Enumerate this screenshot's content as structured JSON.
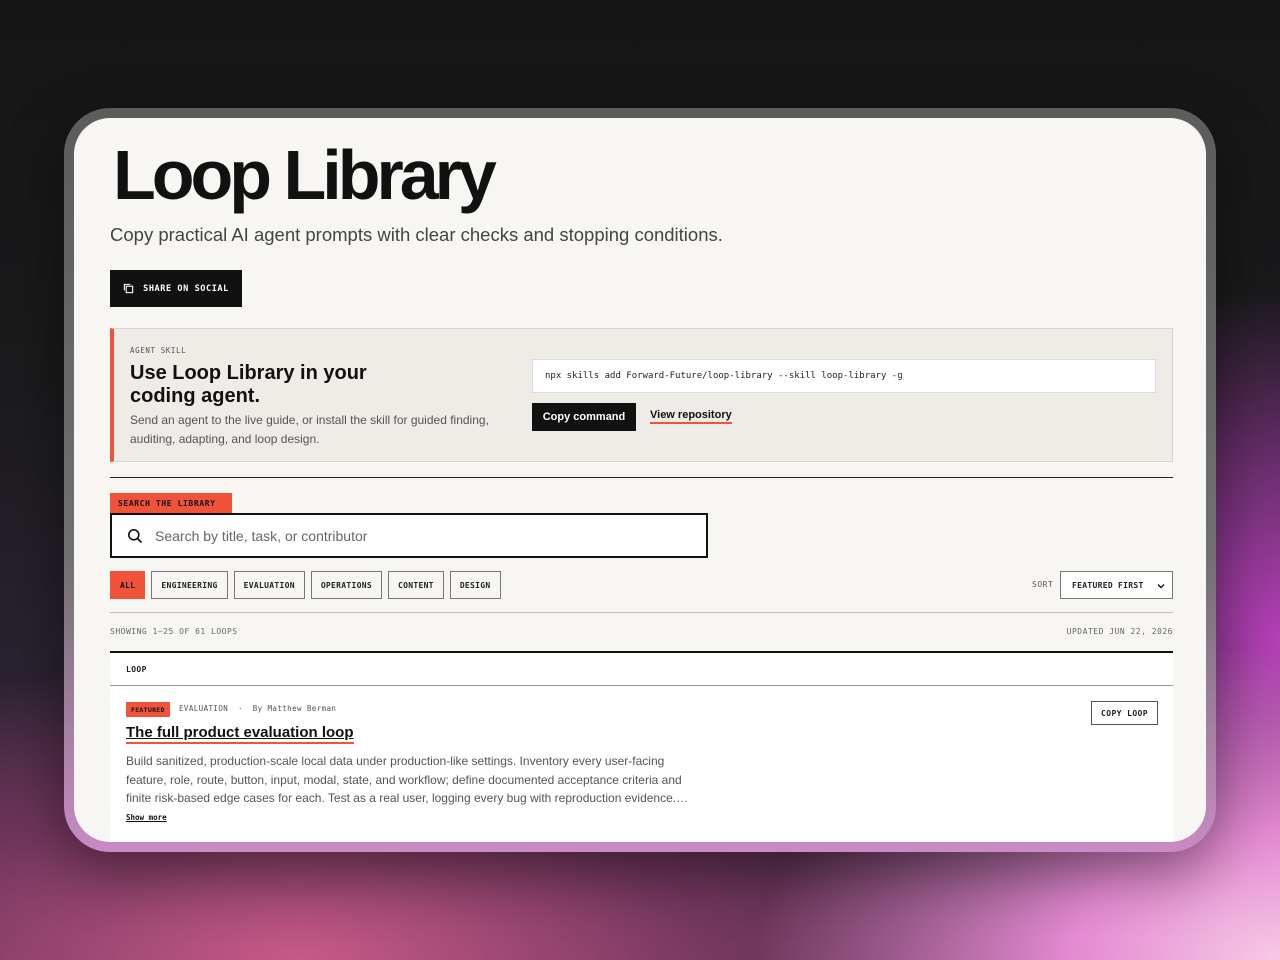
{
  "header": {
    "title": "Loop Library",
    "subtitle": "Copy practical AI agent prompts with clear checks and stopping conditions.",
    "share_label": "SHARE ON SOCIAL"
  },
  "agent_skill": {
    "kicker": "AGENT SKILL",
    "title": "Use Loop Library in your coding agent.",
    "description": "Send an agent to the live guide, or install the skill for guided finding, auditing, adapting, and loop design.",
    "command": "npx skills add Forward-Future/loop-library --skill loop-library -g",
    "copy_label": "Copy command",
    "repo_label": "View repository"
  },
  "search": {
    "label": "SEARCH THE LIBRARY",
    "placeholder": "Search by title, task, or contributor"
  },
  "filters": [
    "ALL",
    "ENGINEERING",
    "EVALUATION",
    "OPERATIONS",
    "CONTENT",
    "DESIGN"
  ],
  "sort": {
    "label": "SORT",
    "value": "FEATURED FIRST"
  },
  "status": {
    "showing": "SHOWING 1–25 OF 61 LOOPS",
    "updated": "UPDATED JUN 22, 2026"
  },
  "table": {
    "column": "LOOP"
  },
  "loops": [
    {
      "badge": "FEATURED",
      "category": "EVALUATION",
      "author": "By Matthew Berman",
      "title": "The full product evaluation loop",
      "description": "Build sanitized, production-scale local data under production-like settings. Inventory every user-facing feature, role, route, button, input, modal, state, and workflow; define documented acceptance criteria and finite risk-based edge cases for each. Test as a real user, logging every bug with reproduction evidence.…",
      "show_more": "Show more",
      "copy_label": "COPY LOOP"
    }
  ],
  "colors": {
    "accent": "#f0533a",
    "ink": "#111111",
    "paper": "#f7f6f3"
  }
}
